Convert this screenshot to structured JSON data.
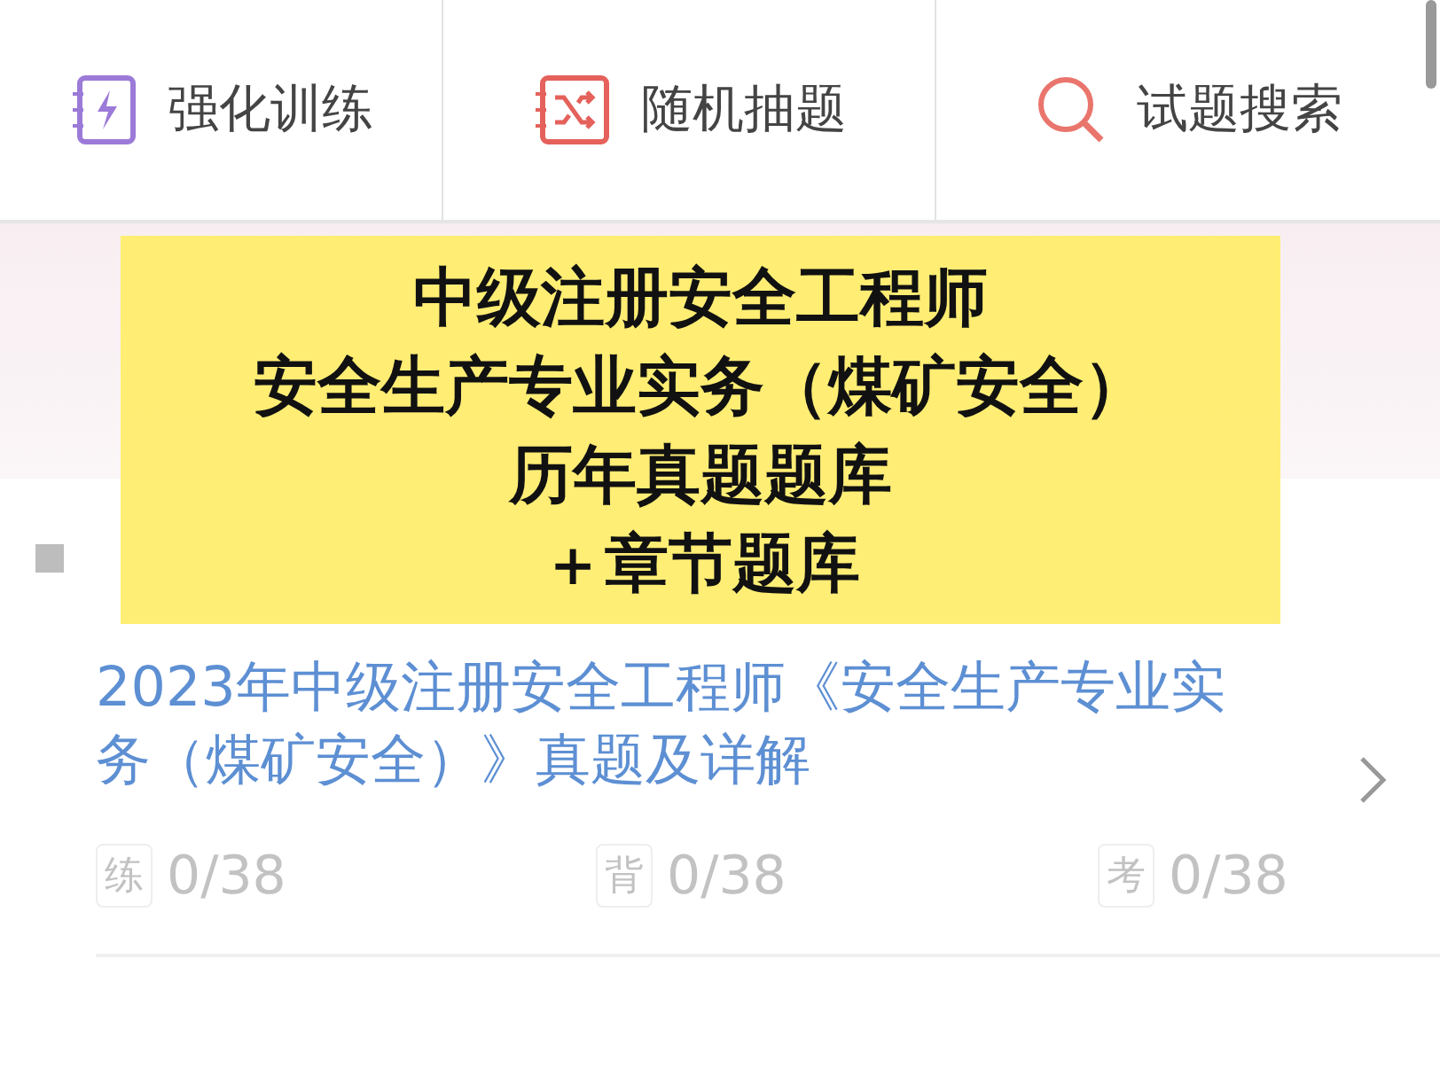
{
  "toolbar": [
    {
      "kind": "train",
      "label": "强化训练"
    },
    {
      "kind": "random",
      "label": "随机抽题"
    },
    {
      "kind": "search",
      "label": "试题搜索"
    }
  ],
  "overlay": {
    "lines": [
      "中级注册安全工程师",
      "安全生产专业实务（煤矿安全）",
      "历年真题题库",
      "＋章节题库"
    ]
  },
  "items": [
    {
      "title": "2023年中级注册安全工程师《安全生产专业实务（煤矿安全）》真题及详解",
      "stats": [
        {
          "badge": "练",
          "count": "0/38"
        },
        {
          "badge": "背",
          "count": "0/38"
        },
        {
          "badge": "考",
          "count": "0/38"
        }
      ]
    }
  ]
}
